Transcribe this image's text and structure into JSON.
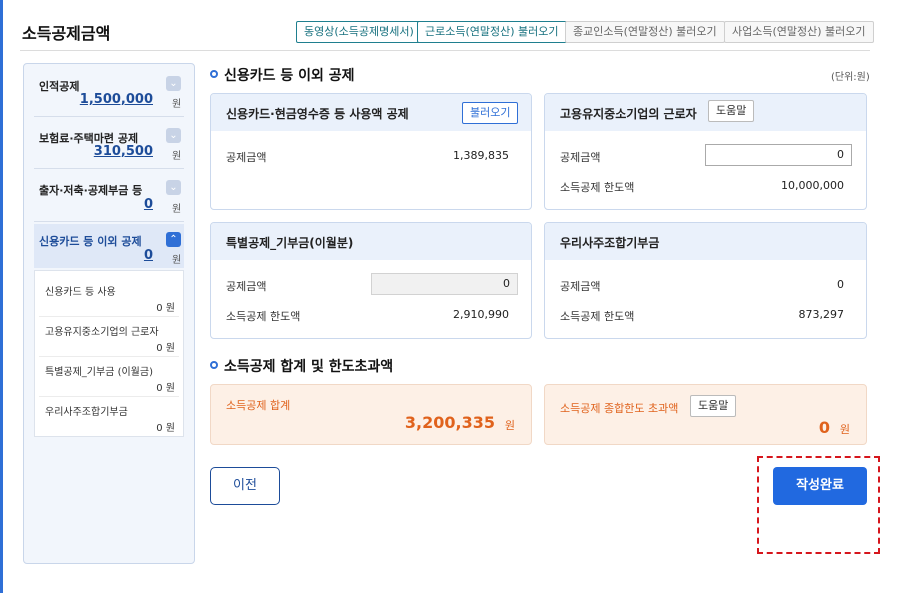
{
  "page_title": "소득공제금액",
  "header_buttons": [
    {
      "label": "동영상(소득공제명세서)"
    },
    {
      "label": "근로소득(연말정산) 불러오기"
    },
    {
      "label": "종교인소득(연말정산) 불러오기"
    },
    {
      "label": "사업소득(연말정산) 불러오기"
    }
  ],
  "sidebar": {
    "items": [
      {
        "label": "인적공제",
        "value": "1,500,000",
        "unit": "원"
      },
      {
        "label": "보험료·주택마련 공제",
        "value": "310,500",
        "unit": "원"
      },
      {
        "label": "출자·저축·공제부금 등",
        "value": "0",
        "unit": "원"
      },
      {
        "label": "신용카드 등 이외 공제",
        "value": "0",
        "unit": "원"
      }
    ],
    "sub_items": [
      {
        "label": "신용카드 등 사용",
        "value": "0 원"
      },
      {
        "label": "고용유지중소기업의 근로자",
        "value": "0 원"
      },
      {
        "label": "특별공제_기부금 (이월금)",
        "value": "0 원"
      },
      {
        "label": "우리사주조합기부금",
        "value": "0 원"
      }
    ]
  },
  "main": {
    "section1_title": "신용카드 등 이외 공제",
    "unit_note": "(단위:원)",
    "cards": {
      "credit": {
        "title": "신용카드·현금영수증 등 사용액 공제",
        "button": "불러오기",
        "amount_label": "공제금액",
        "amount": "1,389,835"
      },
      "smb": {
        "title": "고용유지중소기업의 근로자",
        "button": "도움말",
        "amount_label": "공제금액",
        "amount_input": "0",
        "limit_label": "소득공제 한도액",
        "limit": "10,000,000"
      },
      "donation": {
        "title": "특별공제_기부금(이월분)",
        "amount_label": "공제금액",
        "amount_input": "0",
        "limit_label": "소득공제 한도액",
        "limit": "2,910,990"
      },
      "esop": {
        "title": "우리사주조합기부금",
        "amount_label": "공제금액",
        "amount": "0",
        "limit_label": "소득공제 한도액",
        "limit": "873,297"
      }
    },
    "section2_title": "소득공제 합계 및 한도초과액",
    "summary": {
      "total_label": "소득공제 합계",
      "total_value": "3,200,335",
      "total_unit": "원",
      "excess_label": "소득공제 종합한도 초과액",
      "excess_button": "도움말",
      "excess_value": "0",
      "excess_unit": "원"
    },
    "buttons": {
      "prev": "이전",
      "done": "작성완료"
    }
  },
  "colors": {
    "accent": "#2169e0",
    "summary_text": "#e0621c",
    "highlight": "#d6161c"
  }
}
